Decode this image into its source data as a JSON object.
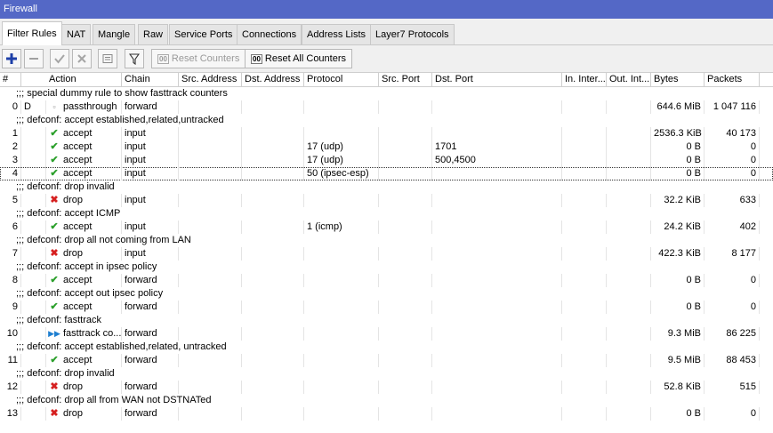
{
  "window": {
    "title": "Firewall"
  },
  "tabs": [
    {
      "label": "Filter Rules"
    },
    {
      "label": "NAT"
    },
    {
      "label": "Mangle"
    },
    {
      "label": "Raw"
    },
    {
      "label": "Service Ports"
    },
    {
      "label": "Connections"
    },
    {
      "label": "Address Lists"
    },
    {
      "label": "Layer7 Protocols"
    }
  ],
  "toolbar": {
    "reset_counters": "Reset Counters",
    "reset_all_counters": "Reset All Counters",
    "counter_glyph": "00"
  },
  "columns": [
    "#",
    "Action",
    "Chain",
    "Src. Address",
    "Dst. Address",
    "Protocol",
    "Src. Port",
    "Dst. Port",
    "In. Inter...",
    "Out. Int...",
    "Bytes",
    "Packets"
  ],
  "rows": [
    {
      "kind": "comment",
      "text": ";;; special dummy rule to show fasttrack counters"
    },
    {
      "kind": "rule",
      "num": "0",
      "flag": "D",
      "icon": "passthrough-icon",
      "action": "passthrough",
      "chain": "forward",
      "protocol": "",
      "dst_port": "",
      "bytes": "644.6 MiB",
      "packets": "1 047 116"
    },
    {
      "kind": "comment",
      "text": ";;; defconf: accept established,related,untracked"
    },
    {
      "kind": "rule",
      "num": "1",
      "flag": "",
      "icon": "accept-icon",
      "action": "accept",
      "chain": "input",
      "protocol": "",
      "dst_port": "",
      "bytes": "2536.3 KiB",
      "packets": "40 173"
    },
    {
      "kind": "rule",
      "num": "2",
      "flag": "",
      "icon": "accept-icon",
      "action": "accept",
      "chain": "input",
      "protocol": "17 (udp)",
      "dst_port": "1701",
      "bytes": "0 B",
      "packets": "0"
    },
    {
      "kind": "rule",
      "num": "3",
      "flag": "",
      "icon": "accept-icon",
      "action": "accept",
      "chain": "input",
      "protocol": "17 (udp)",
      "dst_port": "500,4500",
      "bytes": "0 B",
      "packets": "0"
    },
    {
      "kind": "rule",
      "num": "4",
      "flag": "",
      "icon": "accept-icon",
      "action": "accept",
      "chain": "input",
      "protocol": "50 (ipsec-esp)",
      "dst_port": "",
      "bytes": "0 B",
      "packets": "0",
      "selected": true
    },
    {
      "kind": "comment",
      "text": ";;; defconf: drop invalid"
    },
    {
      "kind": "rule",
      "num": "5",
      "flag": "",
      "icon": "drop-icon",
      "action": "drop",
      "chain": "input",
      "protocol": "",
      "dst_port": "",
      "bytes": "32.2 KiB",
      "packets": "633"
    },
    {
      "kind": "comment",
      "text": ";;; defconf: accept ICMP"
    },
    {
      "kind": "rule",
      "num": "6",
      "flag": "",
      "icon": "accept-icon",
      "action": "accept",
      "chain": "input",
      "protocol": "1 (icmp)",
      "dst_port": "",
      "bytes": "24.2 KiB",
      "packets": "402"
    },
    {
      "kind": "comment",
      "text": ";;; defconf: drop all not coming from LAN"
    },
    {
      "kind": "rule",
      "num": "7",
      "flag": "",
      "icon": "drop-icon",
      "action": "drop",
      "chain": "input",
      "protocol": "",
      "dst_port": "",
      "bytes": "422.3 KiB",
      "packets": "8 177"
    },
    {
      "kind": "comment",
      "text": ";;; defconf: accept in ipsec policy"
    },
    {
      "kind": "rule",
      "num": "8",
      "flag": "",
      "icon": "accept-icon",
      "action": "accept",
      "chain": "forward",
      "protocol": "",
      "dst_port": "",
      "bytes": "0 B",
      "packets": "0"
    },
    {
      "kind": "comment",
      "text": ";;; defconf: accept out ipsec policy"
    },
    {
      "kind": "rule",
      "num": "9",
      "flag": "",
      "icon": "accept-icon",
      "action": "accept",
      "chain": "forward",
      "protocol": "",
      "dst_port": "",
      "bytes": "0 B",
      "packets": "0"
    },
    {
      "kind": "comment",
      "text": ";;; defconf: fasttrack"
    },
    {
      "kind": "rule",
      "num": "10",
      "flag": "",
      "icon": "fasttrack-icon",
      "action": "fasttrack co...",
      "chain": "forward",
      "protocol": "",
      "dst_port": "",
      "bytes": "9.3 MiB",
      "packets": "86 225"
    },
    {
      "kind": "comment",
      "text": ";;; defconf: accept established,related, untracked"
    },
    {
      "kind": "rule",
      "num": "11",
      "flag": "",
      "icon": "accept-icon",
      "action": "accept",
      "chain": "forward",
      "protocol": "",
      "dst_port": "",
      "bytes": "9.5 MiB",
      "packets": "88 453"
    },
    {
      "kind": "comment",
      "text": ";;; defconf: drop invalid"
    },
    {
      "kind": "rule",
      "num": "12",
      "flag": "",
      "icon": "drop-icon",
      "action": "drop",
      "chain": "forward",
      "protocol": "",
      "dst_port": "",
      "bytes": "52.8 KiB",
      "packets": "515"
    },
    {
      "kind": "comment",
      "text": ";;; defconf:  drop all from WAN not DSTNATed"
    },
    {
      "kind": "rule",
      "num": "13",
      "flag": "",
      "icon": "drop-icon",
      "action": "drop",
      "chain": "forward",
      "protocol": "",
      "dst_port": "",
      "bytes": "0 B",
      "packets": "0"
    }
  ]
}
